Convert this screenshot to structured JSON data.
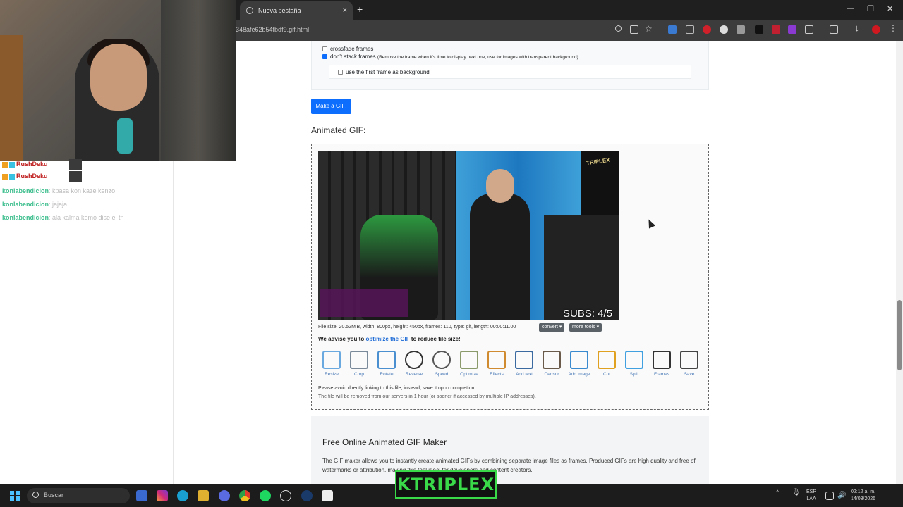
{
  "browser": {
    "tab_title": "Nueva pestaña",
    "url": "348afe62b54fbdf9.gif.html"
  },
  "chat": {
    "lines": [
      {
        "user": "RushDeku",
        "message": ""
      },
      {
        "user": "RushDeku",
        "message": ""
      },
      {
        "user": "konlabendicion",
        "message": ": kpasa kon kaze kenzo"
      },
      {
        "user": "konlabendicion",
        "message": ": jajaja"
      },
      {
        "user": "konlabendicion",
        "message": ": ala kalma komo dise el tn"
      }
    ]
  },
  "options": {
    "crossfade": "crossfade frames",
    "dont_stack": "don't stack frames",
    "dont_stack_note": "(Remove the frame when it's time to display next one, use for images with transparent background)",
    "first_frame_bg": "use the first frame as background"
  },
  "make_gif_label": "Make a GIF!",
  "animated_gif_title": "Animated GIF:",
  "gif_overlay": {
    "subs_text": "SUBS: 4/5",
    "logo_text": "TRIPLEX"
  },
  "file_info": "File size: 20.52MiB, width: 800px, height: 450px, frames: 110, type: gif, length: 00:00:11.00",
  "convert_label": "convert ▾",
  "more_tools_label": "more tools ▾",
  "advise": {
    "prefix": "We advise you to ",
    "link": "optimize the GIF",
    "suffix": " to reduce file size!"
  },
  "tools": [
    {
      "label": "Resize",
      "icon": "resize-icon",
      "color": "#6aa8e0"
    },
    {
      "label": "Crop",
      "icon": "crop-icon",
      "color": "#7a8a9a"
    },
    {
      "label": "Rotate",
      "icon": "rotate-icon",
      "color": "#4a90d0"
    },
    {
      "label": "Reverse",
      "icon": "reverse-icon",
      "color": "#333333"
    },
    {
      "label": "Speed",
      "icon": "speed-icon",
      "color": "#555555"
    },
    {
      "label": "Optimize",
      "icon": "optimize-icon",
      "color": "#8a9a6a"
    },
    {
      "label": "Effects",
      "icon": "effects-icon",
      "color": "#d08a30"
    },
    {
      "label": "Add text",
      "icon": "add-text-icon",
      "color": "#3a6aa0"
    },
    {
      "label": "Censor",
      "icon": "censor-icon",
      "color": "#6a5a4a"
    },
    {
      "label": "Add image",
      "icon": "add-image-icon",
      "color": "#3a8ad0"
    },
    {
      "label": "Cut",
      "icon": "cut-icon",
      "color": "#e0a020"
    },
    {
      "label": "Split",
      "icon": "split-icon",
      "color": "#40a0e0"
    },
    {
      "label": "Frames",
      "icon": "frames-icon",
      "color": "#333333"
    },
    {
      "label": "Save",
      "icon": "save-icon",
      "color": "#444444"
    }
  ],
  "warning": {
    "line1": "Please avoid directly linking to this file; instead, save it upon completion!",
    "line2": "The file will be removed from our servers in 1 hour (or sooner if accessed by multiple IP addresses)."
  },
  "free_section": {
    "title": "Free Online Animated GIF Maker",
    "text": "The GIF maker allows you to instantly create animated GIFs by combining separate image files as frames. Produced GIFs are high quality and free of watermarks or attribution, making this tool ideal for developers and content creators."
  },
  "taskbar": {
    "search_placeholder": "Buscar",
    "brand": "KTRIPLEX",
    "lang_top": "ESP",
    "lang_bottom": "LAA",
    "time": "02:12 a. m.",
    "date": "14/03/2026"
  }
}
